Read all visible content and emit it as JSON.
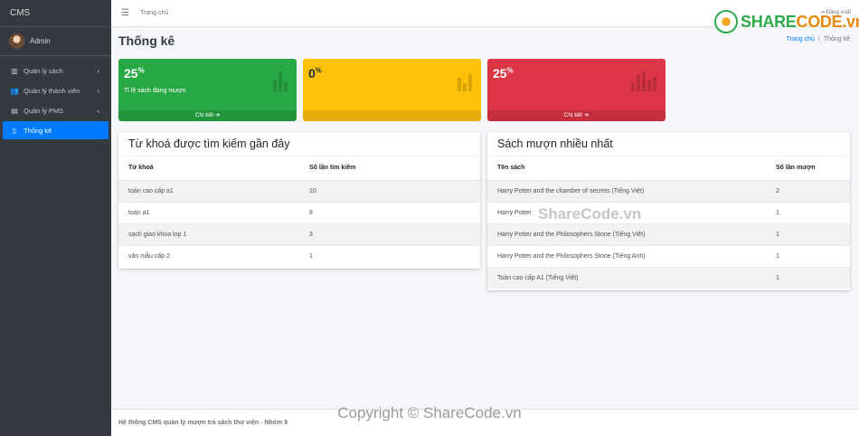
{
  "sidebar": {
    "brand": "CMS",
    "user": "Admin",
    "items": [
      {
        "label": "Quản lý sách",
        "icon": "books-icon"
      },
      {
        "label": "Quản lý thành viên",
        "icon": "users-icon"
      },
      {
        "label": "Quản lý PMS",
        "icon": "book-icon"
      },
      {
        "label": "Thống kê",
        "icon": "file-icon"
      }
    ]
  },
  "topbar": {
    "home": "Trang chủ",
    "logout": "Đăng xuất"
  },
  "header": {
    "title": "Thống kê",
    "breadcrumb": [
      "Trang chủ",
      "Thống kê"
    ]
  },
  "stats": [
    {
      "value": "25",
      "unit": "%",
      "label": "Tỉ lệ sách đang mượn",
      "footer": "Chi tiết ➔",
      "color": "#28a745"
    },
    {
      "value": "0",
      "unit": "%",
      "label": "",
      "footer": "",
      "color": "#ffc107"
    },
    {
      "value": "25",
      "unit": "%",
      "label": "",
      "footer": "Chi tiết ➔",
      "color": "#dc3545"
    }
  ],
  "keywords": {
    "title": "Từ khoá được tìm kiếm gần đây",
    "columns": [
      "Từ khoá",
      "Số lần tìm kiếm"
    ],
    "rows": [
      [
        "toán cao cấp a1",
        "10"
      ],
      [
        "toán a1",
        "8"
      ],
      [
        "sach giao khoa lop 1",
        "3"
      ],
      [
        "văn mẫu cấp 2",
        "1"
      ]
    ]
  },
  "top_books": {
    "title": "Sách mượn nhiều nhất",
    "columns": [
      "Tên sách",
      "Số lần mượn"
    ],
    "rows": [
      [
        "Harry Potter and the chamber of secrets (Tiếng Việt)",
        "2"
      ],
      [
        "Harry Potter",
        "1"
      ],
      [
        "Harry Potter and the Philosophers Stone (Tiếng Việt)",
        "1"
      ],
      [
        "Harry Potter and the Philosophers Stone (Tiếng Anh)",
        "1"
      ],
      [
        "Toán cao cấp A1 (Tiếng Việt)",
        "1"
      ]
    ]
  },
  "footer": {
    "text": "Hệ thống CMS quản lý mượn trả sách thư viện - Nhóm 9",
    "copyright": "Copyright © ShareCode.vn",
    "watermark": "ShareCode.vn"
  },
  "logo": {
    "part1": "SHARE",
    "part2": "CODE.vn"
  }
}
